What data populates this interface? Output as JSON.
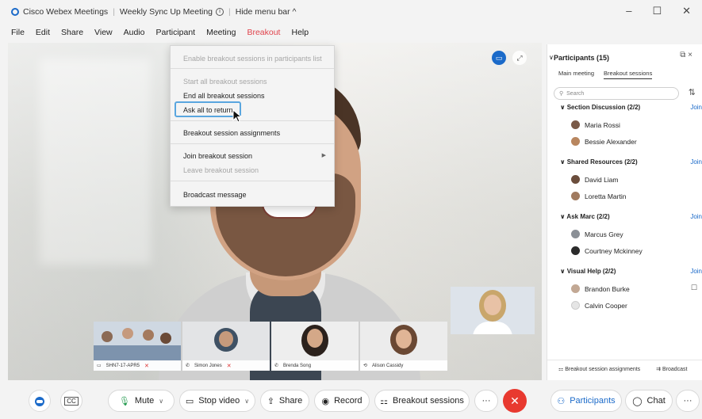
{
  "titlebar": {
    "app_name": "Cisco Webex Meetings",
    "meeting_name": "Weekly Sync Up Meeting",
    "hide_menu": "Hide menu bar ^",
    "info_icon": "info-icon",
    "window_controls": [
      "–",
      "☐",
      "✕"
    ]
  },
  "menu": {
    "items": [
      "File",
      "Edit",
      "Share",
      "View",
      "Audio",
      "Participant",
      "Meeting",
      "Breakout",
      "Help"
    ],
    "active": "Breakout",
    "active_color": "#e0434c"
  },
  "breakout_menu": {
    "enable": "Enable breakout sessions in participants list",
    "start_all": "Start all breakout sessions",
    "end_all": "End all breakout sessions",
    "ask_return": "Ask all to return",
    "assignments": "Breakout session assignments",
    "join": "Join breakout session",
    "leave": "Leave breakout session",
    "broadcast": "Broadcast message"
  },
  "thumbnails": [
    {
      "name": "SHN7-17-APR5"
    },
    {
      "name": "Simon Jones"
    },
    {
      "name": "Brenda Song"
    },
    {
      "name": "Alison Cassidy"
    }
  ],
  "participants": {
    "title": "Participants (15)",
    "tabs": [
      "Main meeting",
      "Breakout sessions"
    ],
    "active_tab": "Breakout sessions",
    "search_placeholder": "Search",
    "join_label": "Join",
    "groups": [
      {
        "name": "Section Discussion (2/2)",
        "members": [
          "Maria Rossi",
          "Bessie Alexander"
        ]
      },
      {
        "name": "Shared Resources (2/2)",
        "members": [
          "David Liam",
          "Loretta Martin"
        ]
      },
      {
        "name": "Ask Marc (2/2)",
        "members": [
          "Marcus Grey",
          "Courtney Mckinney"
        ]
      },
      {
        "name": "Visual Help (2/2)",
        "members": [
          "Brandon Burke",
          "Calvin Cooper"
        ]
      }
    ],
    "footer_assignments": "Breakout session assignments",
    "footer_broadcast": "Broadcast"
  },
  "toolbar": {
    "mute": "Mute",
    "stop_video": "Stop video",
    "share": "Share",
    "record": "Record",
    "breakout": "Breakout sessions",
    "more": "···",
    "end_color": "#e8392f",
    "participants": "Participants",
    "chat": "Chat",
    "more_right": "···",
    "accent": "#1b6ac9"
  }
}
